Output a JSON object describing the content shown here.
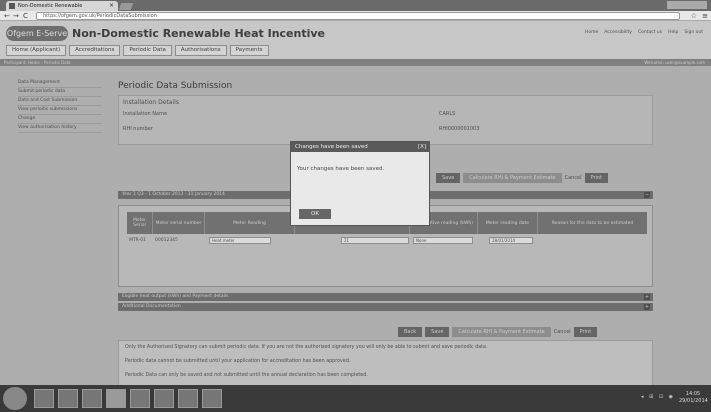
{
  "browser": {
    "tab_title": "Non-Domestic Renewable",
    "url": "https://ofgem.gov.uk/PeriodicDataSubmission",
    "back": "←",
    "forward": "→",
    "reload": "C",
    "star": "☆",
    "menu": "≡"
  },
  "header": {
    "logo": "Ofgem E-Serve",
    "title": "Non-Domestic Renewable Heat Incentive",
    "top_links": [
      "Home",
      "Accessibility",
      "Contact us",
      "Help",
      "Sign out"
    ],
    "nav": [
      "Home (Applicant)",
      "Accreditations",
      "Periodic Data",
      "Authorisations",
      "Payments"
    ]
  },
  "utility_bar": {
    "left": "Participant: Home › Periodic Data",
    "right": "Welcome: user@example.com"
  },
  "sidebar": {
    "items": [
      "Data Management",
      "Submit periodic data",
      "Data and Cost Submission",
      "View periodic submissions",
      "Change",
      "View authorisation history"
    ]
  },
  "main": {
    "heading": "Periodic Data Submission",
    "installation_title": "Installation Details",
    "installation_name_label": "Installation Name",
    "installation_name_value": "CARLS",
    "rhi_number_label": "RHI number",
    "rhi_number_value": "RHI0000001003",
    "buttons_top": {
      "save": "Save",
      "calculate": "Calculate RHI & Payment Estimate",
      "cancel": "Cancel",
      "print": "Print"
    },
    "period_bar": "Year 1 Q3 - 1 October 2013 - 31 January 2014",
    "table_headers": [
      "Meter Serial",
      "Meter serial number",
      "Meter Reading",
      "",
      "Cumulative reading (kWh)",
      "Meter reading date",
      "Reason for the data to be estimated"
    ],
    "row": {
      "serial": "MTR-01",
      "serial_number": "00012345",
      "meter_type": "Heat meter",
      "reading": "21",
      "cumulative": "None",
      "date": "28/01/2014"
    },
    "section_bar_1": "Eligible heat output (kWh) and Payment details",
    "section_bar_2": "Additional Documentation",
    "buttons_bottom": {
      "back": "Back",
      "save": "Save",
      "calculate": "Calculate RHI & Payment Estimate",
      "cancel": "Cancel",
      "print": "Print"
    },
    "notes": [
      "Only the Authorised Signatory can submit periodic data. If you are not the authorised signatory you will only be able to submit and save periodic data.",
      "Periodic data cannot be submitted until your application for accreditation has been approved.",
      "Periodic Data can only be saved and not submitted until the annual declaration has been completed."
    ]
  },
  "modal": {
    "title": "Changes have been saved",
    "close": "[X]",
    "message": "Your changes have been saved.",
    "ok": "OK"
  },
  "taskbar": {
    "tray": "◂ ⊞ ⊡ ◉",
    "time": "14:05",
    "date": "29/01/2014"
  }
}
